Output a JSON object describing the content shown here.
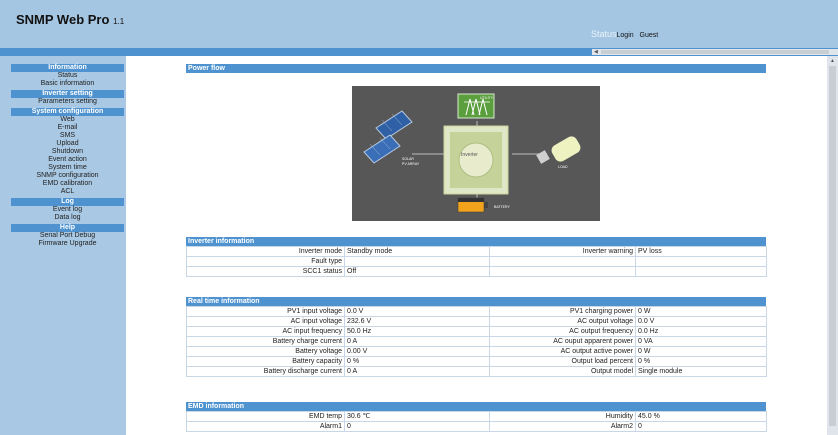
{
  "header": {
    "brand": "SNMP Web Pro",
    "version": "1.1",
    "status_label": "Status",
    "login_label": "Login",
    "user_label": "Guest"
  },
  "sidebar": {
    "sections": [
      {
        "title": "Information",
        "items": [
          "Status",
          "Basic information"
        ]
      },
      {
        "title": "Inverter setting",
        "items": [
          "Parameters setting"
        ]
      },
      {
        "title": "System configuration",
        "items": [
          "Web",
          "E-mail",
          "SMS",
          "Upload",
          "Shutdown",
          "Event action",
          "System time",
          "SNMP configuration",
          "EMD calibration",
          "ACL"
        ]
      },
      {
        "title": "Log",
        "items": [
          "Event log",
          "Data log"
        ]
      },
      {
        "title": "Help",
        "items": [
          "Serial Port Debug",
          "Firmware Upgrade"
        ]
      }
    ]
  },
  "power_flow": {
    "title": "Power flow",
    "labels": {
      "utility": "UTILITY",
      "solar_1": "SOLAR",
      "solar_2": "PV ARRAY",
      "inverter": "Inverter",
      "load": "LOAD",
      "battery": "BATTERY"
    }
  },
  "inverter_info": {
    "title": "Inverter information",
    "rows": [
      [
        "Inverter mode",
        "Standby mode",
        "Inverter warning",
        "PV loss"
      ],
      [
        "Fault type",
        "",
        "",
        ""
      ],
      [
        "SCC1 status",
        "Off",
        "",
        ""
      ]
    ]
  },
  "realtime_info": {
    "title": "Real time information",
    "rows": [
      [
        "PV1 input voltage",
        "0.0 V",
        "PV1 charging power",
        "0 W"
      ],
      [
        "AC input voltage",
        "232.6 V",
        "AC output voltage",
        "0.0 V"
      ],
      [
        "AC input frequency",
        "50.0 Hz",
        "AC output frequency",
        "0.0 Hz"
      ],
      [
        "Battery charge current",
        "0 A",
        "AC ouput apparent power",
        "0 VA"
      ],
      [
        "Battery voltage",
        "0.00 V",
        "AC output active power",
        "0 W"
      ],
      [
        "Battery capacity",
        "0 %",
        "Output load percent",
        "0 %"
      ],
      [
        "Battery discharge current",
        "0 A",
        "Output model",
        "Single module"
      ]
    ]
  },
  "emd_info": {
    "title": "EMD information",
    "rows": [
      [
        "EMD temp",
        "30.6 ℃",
        "Humidity",
        "45.0 %"
      ],
      [
        "Alarm1",
        "0",
        "Alarm2",
        "0"
      ]
    ]
  },
  "colors": {
    "section_blue": "#4e93cf",
    "page_bg": "#a8c8e3",
    "diagram_bg": "#575757"
  }
}
